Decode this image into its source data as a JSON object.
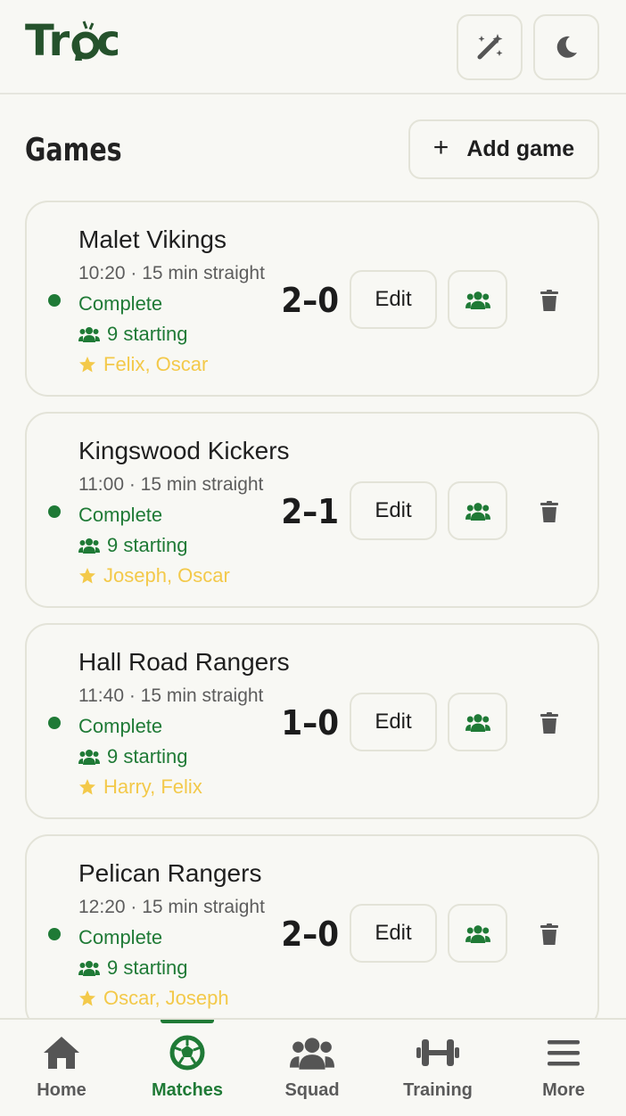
{
  "app": {
    "logo_text": "Trac",
    "magic_label": "magic-wand-icon",
    "theme_label": "moon-icon"
  },
  "page": {
    "title": "Games",
    "add_button_label": "Add game",
    "add_icon": "+"
  },
  "games": [
    {
      "name": "Malet Vikings",
      "meta": "10:20 · 15 min straight",
      "status": "Complete",
      "starting": "9 starting",
      "stars": "Felix, Oscar",
      "score": "2–0",
      "edit_label": "Edit"
    },
    {
      "name": "Kingswood Kickers",
      "meta": "11:00 · 15 min straight",
      "status": "Complete",
      "starting": "9 starting",
      "stars": "Joseph, Oscar",
      "score": "2–1",
      "edit_label": "Edit"
    },
    {
      "name": "Hall Road Rangers",
      "meta": "11:40 · 15 min straight",
      "status": "Complete",
      "starting": "9 starting",
      "stars": "Harry, Felix",
      "score": "1–0",
      "edit_label": "Edit"
    },
    {
      "name": "Pelican Rangers",
      "meta": "12:20 · 15 min straight",
      "status": "Complete",
      "starting": "9 starting",
      "stars": "Oscar, Joseph",
      "score": "2–0",
      "edit_label": "Edit"
    }
  ],
  "nav": [
    {
      "label": "Home",
      "icon": "home-icon",
      "active": false
    },
    {
      "label": "Matches",
      "icon": "football-icon",
      "active": true
    },
    {
      "label": "Squad",
      "icon": "users-icon",
      "active": false
    },
    {
      "label": "Training",
      "icon": "dumbbell-icon",
      "active": false
    },
    {
      "label": "More",
      "icon": "menu-icon",
      "active": false
    }
  ],
  "colors": {
    "brand": "#25522c",
    "accent_green": "#1f7a36",
    "star_yellow": "#f3c94a",
    "background": "#f8f8f4",
    "border": "#e3e3d8"
  }
}
